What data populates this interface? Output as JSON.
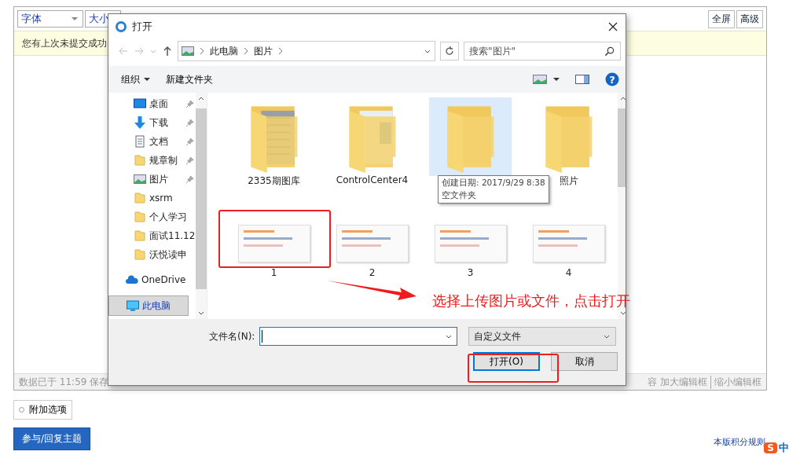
{
  "editor": {
    "font_select": "字体",
    "size_select": "大小",
    "buttons": [
      "全屏",
      "高级"
    ],
    "notice": "您有上次未提交成功",
    "status_left": "数据已于 11:59 保存",
    "status_fragment": "容",
    "status_links": [
      "加大编辑框",
      "缩小编辑框"
    ]
  },
  "attach_options": "附加选项",
  "ime_logo": "S",
  "help_glyph": "?",
  "submit_button": "参与/回复主题",
  "rules_link": "本版积分规则",
  "ime_label": "中",
  "dialog": {
    "title": "打开",
    "address": [
      "此电脑",
      "图片"
    ],
    "search": {
      "placeholder": "搜索\"图片\""
    },
    "organize": "组织",
    "new_folder": "新建文件夹",
    "sidebar": [
      {
        "label": "桌面",
        "kind": "desktop",
        "pinned": true,
        "selected": false
      },
      {
        "label": "下载",
        "kind": "download",
        "pinned": true,
        "selected": false
      },
      {
        "label": "文档",
        "kind": "document",
        "pinned": true,
        "selected": false
      },
      {
        "label": "规章制",
        "kind": "folder",
        "pinned": true,
        "selected": false
      },
      {
        "label": "图片",
        "kind": "pictures",
        "pinned": true,
        "selected": false
      },
      {
        "label": "xsrm",
        "kind": "folder",
        "pinned": false,
        "selected": false
      },
      {
        "label": "个人学习",
        "kind": "folder",
        "pinned": false,
        "selected": false
      },
      {
        "label": "面试11.12",
        "kind": "folder",
        "pinned": false,
        "selected": false
      },
      {
        "label": "沃悦读申",
        "kind": "folder",
        "pinned": false,
        "selected": false
      },
      {
        "label": "OneDrive",
        "kind": "cloud",
        "pinned": false,
        "selected": false
      },
      {
        "label": "此电脑",
        "kind": "computer",
        "pinned": false,
        "selected": true
      }
    ],
    "files": [
      {
        "name": "2335期图库",
        "kind": "folder-preview",
        "highlighted": false
      },
      {
        "name": "ControlCenter4",
        "kind": "folder-preview",
        "highlighted": false
      },
      {
        "kind": "folder",
        "highlighted": true
      },
      {
        "name": "照片",
        "kind": "folder",
        "highlighted": false
      },
      {
        "name": "1",
        "kind": "image",
        "highlighted": false
      },
      {
        "name": "2",
        "kind": "image",
        "highlighted": false
      },
      {
        "name": "3",
        "kind": "image",
        "highlighted": false
      },
      {
        "name": "4",
        "kind": "image",
        "highlighted": false
      }
    ],
    "tooltip": [
      "创建日期: 2017/9/29 8:38",
      "空文件夹"
    ],
    "filename_label": "文件名(N):",
    "filetype": "自定义文件",
    "buttons": [
      {
        "label": "打开(O)",
        "default": true
      },
      {
        "label": "取消",
        "default": false
      }
    ]
  },
  "annotation": "选择上传图片或文件，点击打开"
}
